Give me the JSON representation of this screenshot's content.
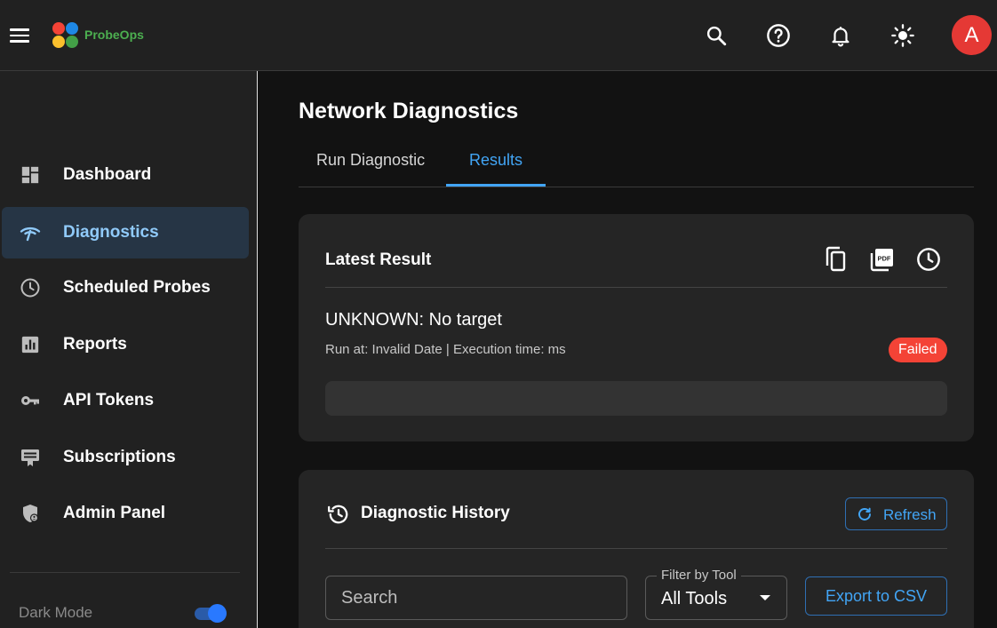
{
  "app": {
    "brand": "ProbeOps",
    "avatar_initial": "A"
  },
  "topbar": {
    "icons": [
      "menu-icon",
      "search-icon",
      "help-icon",
      "bell-icon",
      "brightness-icon"
    ]
  },
  "colors": {
    "accent": "#42a5f5",
    "brand_text": "#4caf50",
    "avatar_bg": "#e53935",
    "failed_badge": "#f44336",
    "active_nav_bg": "#263545",
    "logo_dots": [
      "#f44336",
      "#1e88e5",
      "#fbc02d",
      "#43a047"
    ]
  },
  "sidebar": {
    "items": [
      {
        "label": "Dashboard",
        "icon": "dashboard-icon",
        "active": false
      },
      {
        "label": "Diagnostics",
        "icon": "wifi-diagnostics-icon",
        "active": true
      },
      {
        "label": "Scheduled Probes",
        "icon": "clock-icon",
        "active": false
      },
      {
        "label": "Reports",
        "icon": "bar-chart-icon",
        "active": false
      },
      {
        "label": "API Tokens",
        "icon": "key-icon",
        "active": false
      },
      {
        "label": "Subscriptions",
        "icon": "subscription-card-icon",
        "active": false
      },
      {
        "label": "Admin Panel",
        "icon": "admin-shield-icon",
        "active": false
      }
    ],
    "dark_mode_label": "Dark Mode",
    "dark_mode_on": true
  },
  "main": {
    "title": "Network Diagnostics",
    "tabs": [
      {
        "label": "Run Diagnostic",
        "active": false
      },
      {
        "label": "Results",
        "active": true
      }
    ],
    "latest_result": {
      "title": "Latest Result",
      "actions": [
        "copy-icon",
        "pdf-icon",
        "history-clock-icon"
      ],
      "result_title": "UNKNOWN: No target",
      "meta": "Run at: Invalid Date | Execution time: ms",
      "status": "Failed",
      "output": ""
    },
    "history": {
      "title": "Diagnostic History",
      "refresh_label": "Refresh",
      "search_placeholder": "Search",
      "filter_label": "Filter by Tool",
      "filter_value": "All Tools",
      "export_label": "Export to CSV"
    }
  }
}
